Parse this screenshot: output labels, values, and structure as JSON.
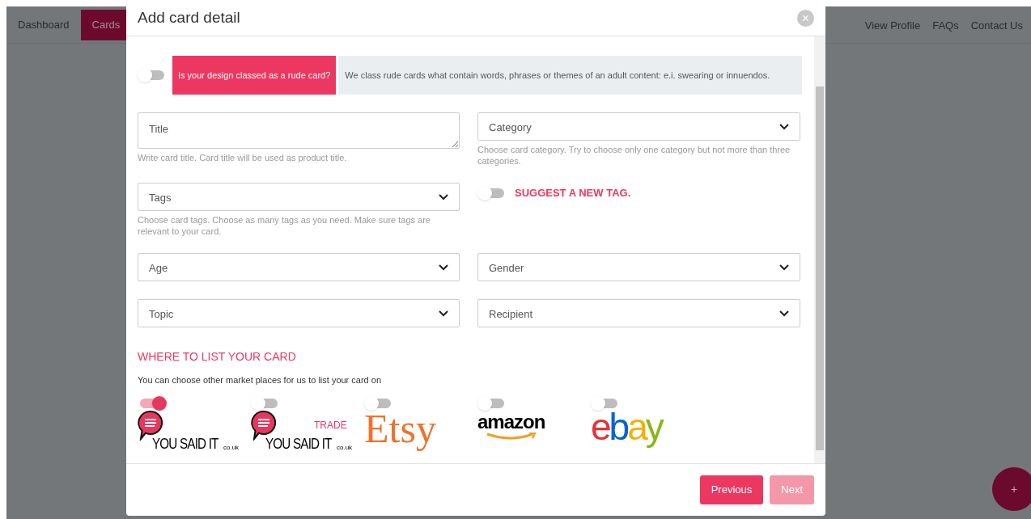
{
  "nav": {
    "items": [
      {
        "label": "Dashboard",
        "selected": false
      },
      {
        "label": "Cards",
        "selected": true
      }
    ],
    "right_links": [
      "View Profile",
      "FAQs",
      "Contact Us"
    ]
  },
  "modal": {
    "title": "Add card detail",
    "close": "×",
    "rude": {
      "on": false,
      "question": "Is your design classed as a rude card?",
      "info": "We class rude cards what contain words, phrases or themes of an adult content: e.i. swearing or innuendos."
    },
    "fields": [
      {
        "kind": "textarea",
        "placeholder": "Title",
        "help": "Write card title. Card title will be used as product title."
      },
      {
        "kind": "select",
        "placeholder": "Category",
        "help": "Choose card category. Try to choose only one category but not more than three categories."
      },
      {
        "kind": "select",
        "placeholder": "Tags",
        "help": "Choose card tags. Choose as many tags as you need. Make sure tags are relevant to your card."
      },
      {
        "kind": "toggle",
        "on": false,
        "label": "SUGGEST A NEW TAG."
      },
      {
        "kind": "select",
        "placeholder": "Age"
      },
      {
        "kind": "select",
        "placeholder": "Gender"
      },
      {
        "kind": "select",
        "placeholder": "Topic"
      },
      {
        "kind": "select",
        "placeholder": "Recipient"
      }
    ],
    "listing": {
      "heading": "WHERE TO LIST YOUR CARD",
      "subtext": "You can choose other market places for us to list your card on",
      "markets": [
        {
          "kind": "yousaidit",
          "on": true,
          "logo_text": "YOU SAID IT",
          "suffix": "co.uk"
        },
        {
          "kind": "yousaidit_trade",
          "on": false,
          "logo_text": "YOU SAID IT",
          "suffix": "co.uk",
          "badge": "TRADE"
        },
        {
          "kind": "etsy",
          "on": false,
          "logo_text": "Etsy"
        },
        {
          "kind": "amazon",
          "on": false,
          "logo_text": "amazon"
        },
        {
          "kind": "ebay",
          "on": false,
          "logo_text": "ebay"
        }
      ]
    },
    "buttons": [
      {
        "label": "Previous",
        "disabled": false
      },
      {
        "label": "Next",
        "disabled": true
      }
    ]
  },
  "fab": "+"
}
